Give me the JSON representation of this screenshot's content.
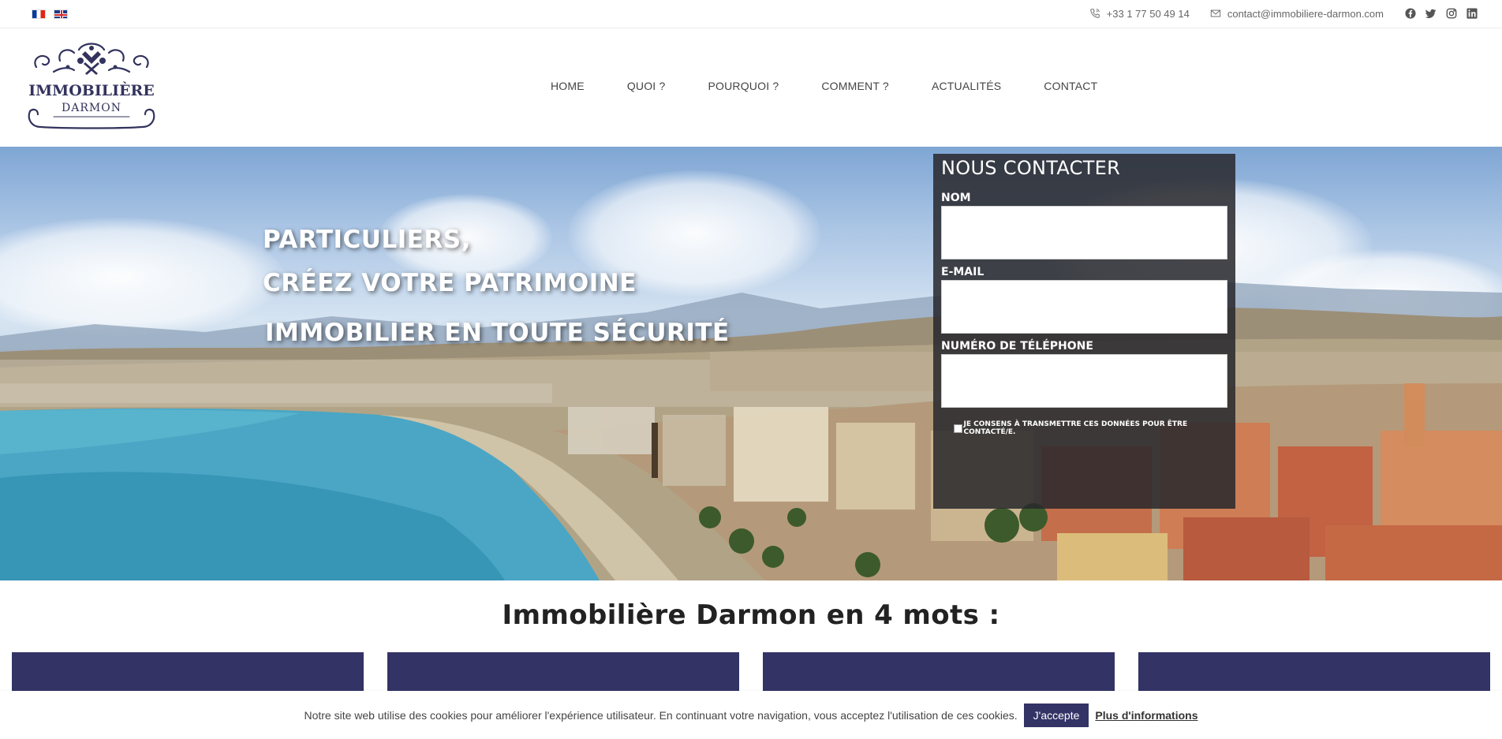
{
  "topbar": {
    "languages": [
      {
        "code": "fr",
        "icon": "france-flag-icon"
      },
      {
        "code": "en",
        "icon": "uk-flag-icon"
      }
    ],
    "phone": "+33 1 77 50 49 14",
    "email": "contact@immobiliere-darmon.com",
    "socials": [
      "facebook-icon",
      "twitter-icon",
      "instagram-icon",
      "linkedin-icon"
    ]
  },
  "logo": {
    "line1": "IMMOBILIÈRE",
    "line2": "DARMON"
  },
  "nav": {
    "items": [
      "HOME",
      "QUOI ?",
      "POURQUOI ?",
      "COMMENT ?",
      "ACTUALITÉS",
      "CONTACT"
    ]
  },
  "hero": {
    "line1": "PARTICULIERS,",
    "line2": "CRÉEZ VOTRE PATRIMOINE",
    "line3": "IMMOBILIER EN TOUTE SÉCURITÉ"
  },
  "form": {
    "title": "NOUS CONTACTER",
    "name_label": "NOM",
    "email_label": "E-MAIL",
    "phone_label": "NUMÉRO DE TÉLÉPHONE",
    "name_value": "",
    "email_value": "",
    "phone_value": "",
    "consent": "JE CONSENS À TRANSMETTRE CES DONNÉES POUR ÊTRE CONTACTÉ/E."
  },
  "section": {
    "title": "Immobilière Darmon en 4 mots :"
  },
  "cookie": {
    "text": "Notre site web utilise des cookies pour améliorer l'expérience utilisateur. En continuant votre navigation, vous acceptez l'utilisation de ces cookies.",
    "accept": "J'accepte",
    "more": "Plus d'informations"
  },
  "colors": {
    "brand": "#333366",
    "form_bg": "#28282c"
  }
}
